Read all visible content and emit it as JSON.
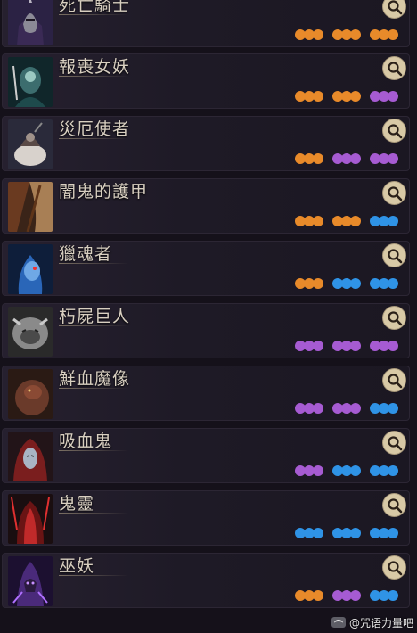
{
  "colors": {
    "orange": "#e88a2a",
    "purple": "#a65bd2",
    "blue": "#2f93e6",
    "search_bg": "#d8c9a6",
    "search_fg": "#2a2018"
  },
  "rows": [
    {
      "name": "死亡騎士",
      "portrait": "death-knight-portrait",
      "groups": [
        [
          "orange",
          "orange",
          "orange"
        ],
        [
          "orange",
          "orange",
          "orange"
        ],
        [
          "orange",
          "orange",
          "orange"
        ]
      ]
    },
    {
      "name": "報喪女妖",
      "portrait": "banshee-portrait",
      "groups": [
        [
          "orange",
          "orange",
          "orange"
        ],
        [
          "orange",
          "orange",
          "orange"
        ],
        [
          "purple",
          "purple",
          "purple"
        ]
      ]
    },
    {
      "name": "災厄使者",
      "portrait": "doom-bringer-portrait",
      "groups": [
        [
          "orange",
          "orange",
          "orange"
        ],
        [
          "purple",
          "purple",
          "purple"
        ],
        [
          "purple",
          "purple",
          "purple"
        ]
      ]
    },
    {
      "name": "闇鬼的護甲",
      "portrait": "shadow-armor-portrait",
      "groups": [
        [
          "orange",
          "orange",
          "orange"
        ],
        [
          "orange",
          "orange",
          "orange"
        ],
        [
          "blue",
          "blue",
          "blue"
        ]
      ]
    },
    {
      "name": "獵魂者",
      "portrait": "soul-hunter-portrait",
      "groups": [
        [
          "orange",
          "orange",
          "orange"
        ],
        [
          "blue",
          "blue",
          "blue"
        ],
        [
          "blue",
          "blue",
          "blue"
        ]
      ]
    },
    {
      "name": "朽屍巨人",
      "portrait": "corpse-giant-portrait",
      "groups": [
        [
          "purple",
          "purple",
          "purple"
        ],
        [
          "purple",
          "purple",
          "purple"
        ],
        [
          "purple",
          "purple",
          "purple"
        ]
      ]
    },
    {
      "name": "鮮血魔像",
      "portrait": "blood-golem-portrait",
      "groups": [
        [
          "purple",
          "purple",
          "purple"
        ],
        [
          "purple",
          "purple",
          "purple"
        ],
        [
          "blue",
          "blue",
          "blue"
        ]
      ]
    },
    {
      "name": "吸血鬼",
      "portrait": "vampire-portrait",
      "groups": [
        [
          "purple",
          "purple",
          "purple"
        ],
        [
          "blue",
          "blue",
          "blue"
        ],
        [
          "blue",
          "blue",
          "blue"
        ]
      ]
    },
    {
      "name": "鬼靈",
      "portrait": "wraith-portrait",
      "groups": [
        [
          "blue",
          "blue",
          "blue"
        ],
        [
          "blue",
          "blue",
          "blue"
        ],
        [
          "blue",
          "blue",
          "blue"
        ]
      ]
    },
    {
      "name": "巫妖",
      "portrait": "lich-portrait",
      "groups": [
        [
          "orange",
          "orange",
          "orange"
        ],
        [
          "purple",
          "purple",
          "purple"
        ],
        [
          "blue",
          "blue",
          "blue"
        ]
      ]
    }
  ],
  "search_icon": "magnifier-icon",
  "watermark": {
    "text": "@咒语力量吧",
    "icon": "tieba-logo-icon"
  }
}
